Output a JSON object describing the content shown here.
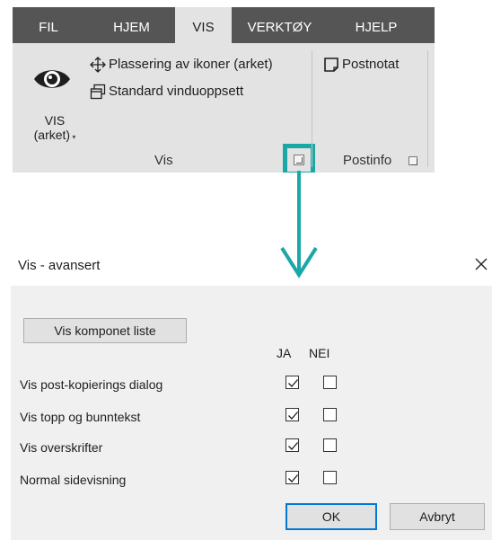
{
  "ribbon": {
    "tabs": [
      {
        "label": "FIL",
        "active": false
      },
      {
        "label": "HJEM",
        "active": false
      },
      {
        "label": "VIS",
        "active": true
      },
      {
        "label": "VERKTØY",
        "active": false
      },
      {
        "label": "HJELP",
        "active": false
      }
    ],
    "vis_arket_line1": "VIS",
    "vis_arket_line2": "(arket)",
    "placement_icons": "Plassering av ikoner (arket)",
    "standard_window": "Standard vinduoppsett",
    "vis_group_label": "Vis",
    "postnotat": "Postnotat",
    "postinfo_group_label": "Postinfo"
  },
  "dialog": {
    "title": "Vis - avansert",
    "component_list_button": "Vis komponet liste",
    "col_yes": "JA",
    "col_no": "NEI",
    "rows": [
      {
        "label": "Vis post-kopierings dialog",
        "ja": true,
        "nei": false
      },
      {
        "label": "Vis topp og bunntekst",
        "ja": true,
        "nei": false
      },
      {
        "label": "Vis overskrifter",
        "ja": true,
        "nei": false
      },
      {
        "label": "Normal sidevisning",
        "ja": true,
        "nei": false
      }
    ],
    "ok_button": "OK",
    "cancel_button": "Avbryt"
  },
  "colors": {
    "tabbar": "#555555",
    "ribbon": "#e3e3e3",
    "highlight": "#1aa8a6",
    "dialog_bg": "#f0f0f0",
    "focus_border": "#0078d7"
  }
}
